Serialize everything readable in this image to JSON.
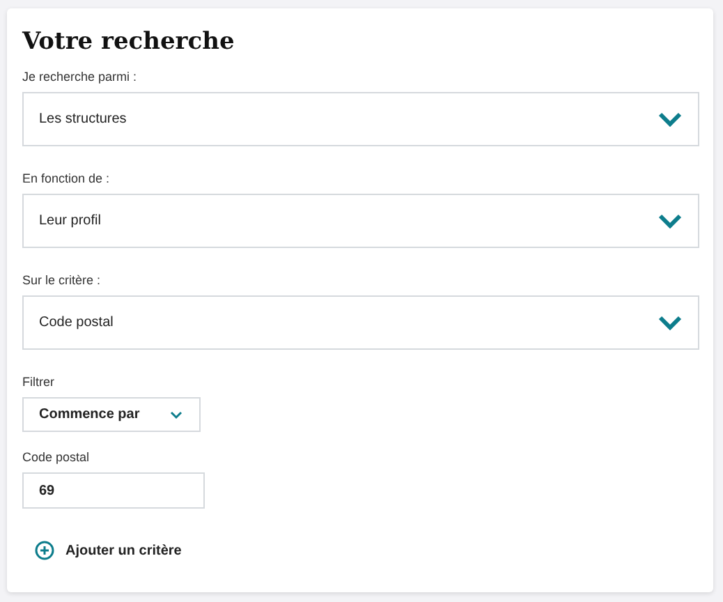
{
  "title": "Votre recherche",
  "selects": [
    {
      "label": "Je recherche parmi :",
      "value": "Les structures"
    },
    {
      "label": "En fonction de :",
      "value": "Leur profil"
    },
    {
      "label": "Sur le critère :",
      "value": "Code postal"
    }
  ],
  "filter": {
    "label": "Filtrer",
    "value": "Commence par"
  },
  "postal": {
    "label": "Code postal",
    "value": "69"
  },
  "add_button": {
    "label": "Ajouter un critère"
  }
}
